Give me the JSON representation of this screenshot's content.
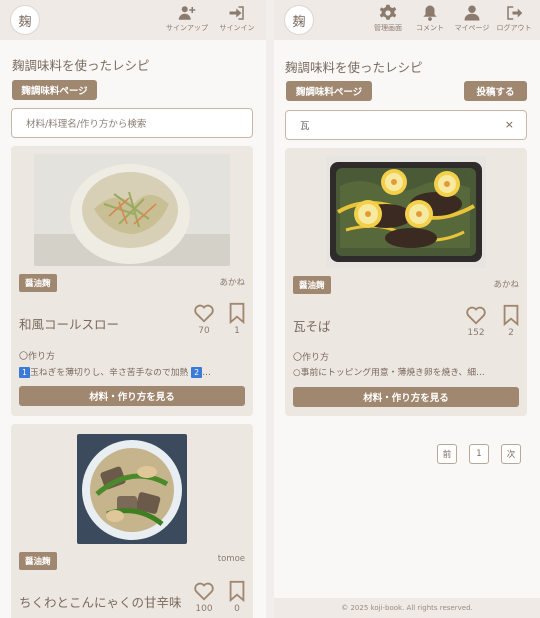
{
  "logo_text": "麹",
  "left": {
    "nav": [
      {
        "label": "サインアップ",
        "icon": "user-plus-icon"
      },
      {
        "label": "サインイン",
        "icon": "sign-in-icon"
      }
    ],
    "heading": "麹調味料を使ったレシピ",
    "koji_page_button": "麹調味料ページ",
    "search_placeholder": "材料/料理名/作り方から検索",
    "cards": [
      {
        "tag": "醤油麹",
        "author": "あかね",
        "title": "和風コールスロー",
        "likes": "70",
        "bookmarks": "1",
        "howto_label": "〇作り方",
        "step_badge_1": "1",
        "step_text": "玉ねぎを薄切りし、辛さ苦手なので加熱",
        "step_badge_2": "2",
        "step_more": "…",
        "view_button": "材料・作り方を見る"
      },
      {
        "tag": "醤油麹",
        "author": "tomoe",
        "title": "ちくわとこんにゃくの甘辛味",
        "likes": "100",
        "bookmarks": "0"
      }
    ]
  },
  "right": {
    "nav": [
      {
        "label": "管理画面",
        "icon": "gear-icon"
      },
      {
        "label": "コメント",
        "icon": "bell-icon"
      },
      {
        "label": "マイページ",
        "icon": "user-icon"
      },
      {
        "label": "ログアウト",
        "icon": "sign-out-icon"
      }
    ],
    "heading": "麹調味料を使ったレシピ",
    "koji_page_button": "麹調味料ページ",
    "post_button": "投稿する",
    "search_value": "瓦",
    "clear_symbol": "×",
    "card": {
      "tag": "醤油麹",
      "author": "あかね",
      "title": "瓦そば",
      "likes": "152",
      "bookmarks": "2",
      "howto_label": "〇作り方",
      "step_text": "○事前にトッピング用意・薄焼き卵を焼き、細…",
      "view_button": "材料・作り方を見る"
    },
    "pagination": {
      "prev": "前",
      "current": "1",
      "next": "次"
    },
    "footer": "© 2025 koji-book. All rights reserved."
  }
}
